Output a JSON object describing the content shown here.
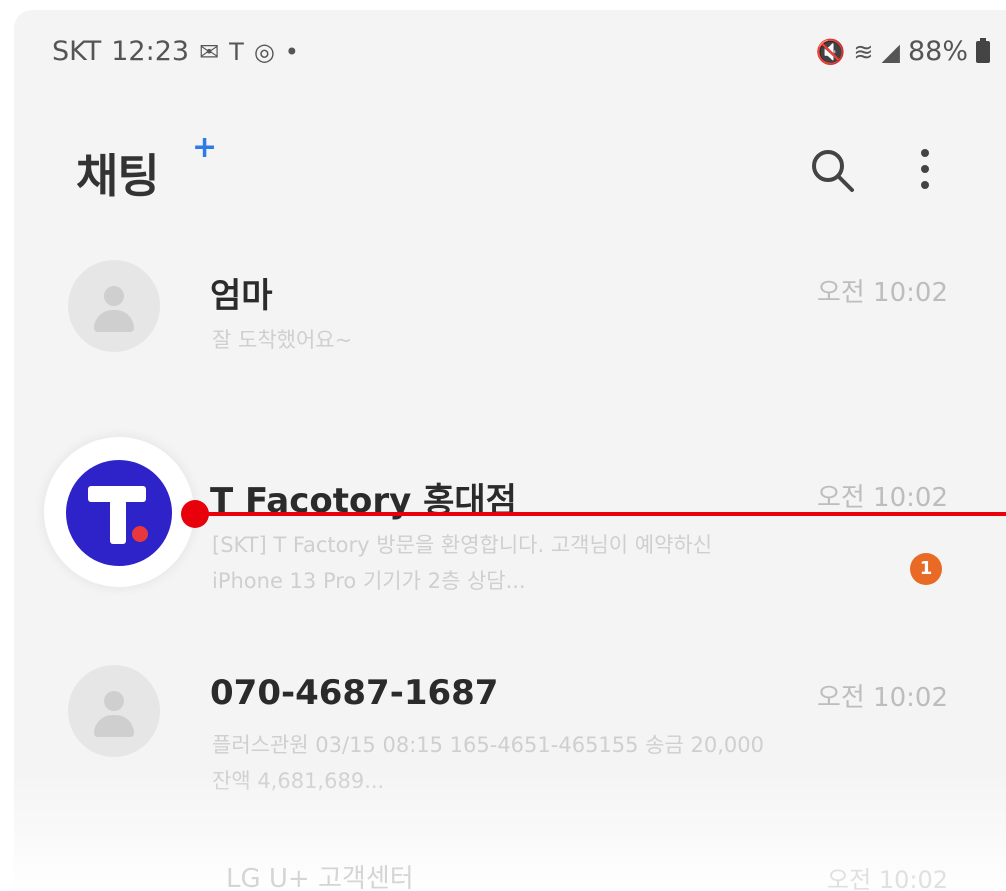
{
  "status_bar": {
    "carrier": "SKT",
    "time": "12:23",
    "battery": "88%"
  },
  "header": {
    "title": "채팅",
    "title_plus": "+"
  },
  "chats": [
    {
      "name": "엄마",
      "time": "오전 10:02",
      "preview": "잘 도착했어요~"
    },
    {
      "name": "T Facotory 홍대점",
      "time": "오전 10:02",
      "preview": "[SKT] T Factory 방문을 환영합니다. 고객님이 예약하신 iPhone 13 Pro 기기가 2층 상담...",
      "unread": "1"
    },
    {
      "name": "070-4687-1687",
      "time": "오전 10:02",
      "preview": "플러스관원 03/15 08:15 165-4651-465155 송금 20,000 잔액 4,681,689..."
    },
    {
      "name": "LG U+ 고객센터",
      "time": "오전 10:02"
    }
  ],
  "colors": {
    "accent_blue": "#2e7be8",
    "brand_t": "#2e22c9",
    "badge_orange": "#e86a24",
    "pointer_red": "#e8000b"
  }
}
